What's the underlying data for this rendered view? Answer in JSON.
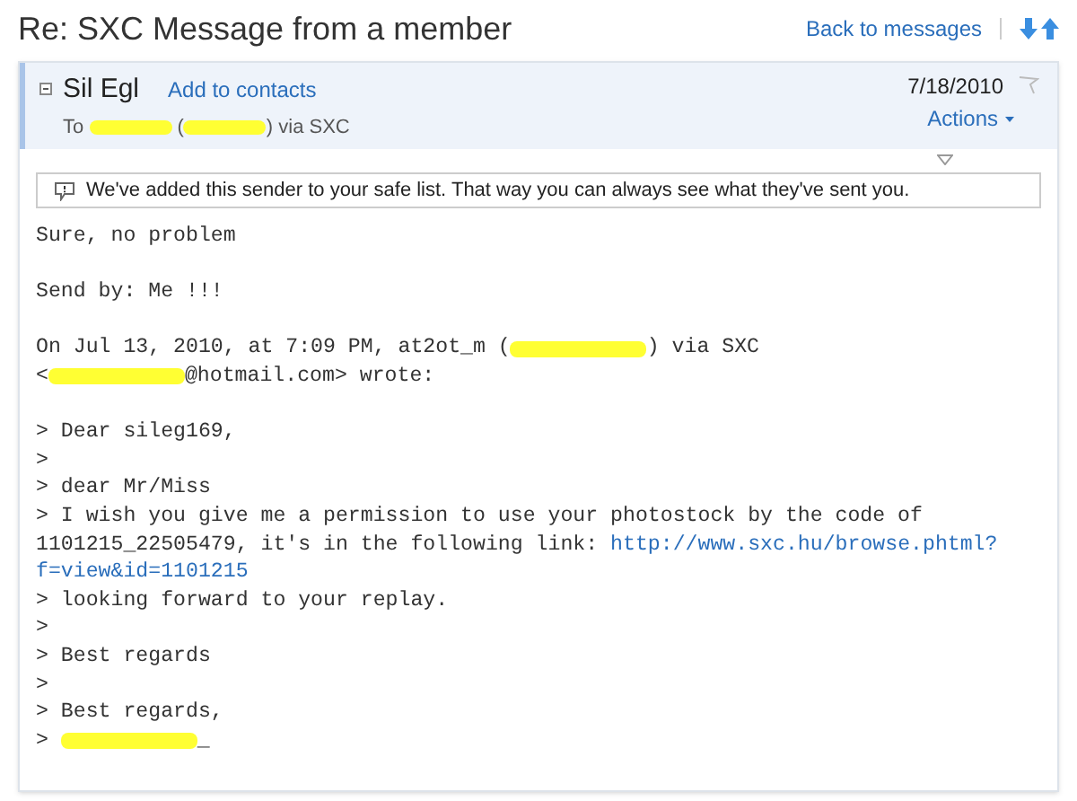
{
  "header": {
    "title": "Re: SXC Message from a member",
    "back_link": "Back to messages"
  },
  "message": {
    "sender": "Sil Egl",
    "add_contact": "Add to contacts",
    "to_line": [
      {
        "kind": "text",
        "text": "To "
      },
      {
        "kind": "redaction"
      },
      {
        "kind": "text",
        "text": " ("
      },
      {
        "kind": "redaction"
      },
      {
        "kind": "text",
        "text": ") via SXC"
      }
    ],
    "date": "7/18/2010",
    "actions": "Actions"
  },
  "notice": {
    "text": "We've added this sender to your safe list. That way you can always see what they've sent you."
  },
  "body": [
    [
      {
        "kind": "text",
        "text": "Sure, no problem"
      }
    ],
    [
      {
        "kind": "blank_line"
      },
      {
        "kind": "text",
        "text": "Send by: Me !!!"
      }
    ],
    [
      {
        "kind": "blank_line"
      },
      {
        "kind": "text",
        "text": "On Jul 13, 2010, at 7:09 PM, at2ot_m ("
      },
      {
        "kind": "redaction"
      },
      {
        "kind": "text",
        "text": ") via SXC"
      }
    ],
    [
      {
        "kind": "text",
        "text": "<"
      },
      {
        "kind": "redaction"
      },
      {
        "kind": "text",
        "text": "@hotmail.com> wrote:"
      }
    ],
    [
      {
        "kind": "blank_line"
      },
      {
        "kind": "text",
        "text": "> Dear sileg169,"
      }
    ],
    [
      {
        "kind": "text",
        "text": ">"
      }
    ],
    [
      {
        "kind": "text",
        "text": "> dear Mr/Miss"
      }
    ],
    [
      {
        "kind": "text",
        "text": "> I wish you give me a permission to use your photostock by the code of"
      }
    ],
    [
      {
        "kind": "text",
        "text": "1101215_22505479, it's in the following link: "
      },
      {
        "kind": "link",
        "text": "http://www.sxc.hu/browse.phtml?"
      }
    ],
    [
      {
        "kind": "link",
        "text": "f=view&id=1101215"
      }
    ],
    [
      {
        "kind": "text",
        "text": "> looking forward to your replay."
      }
    ],
    [
      {
        "kind": "text",
        "text": ">"
      }
    ],
    [
      {
        "kind": "text",
        "text": "> Best regards"
      }
    ],
    [
      {
        "kind": "text",
        "text": ">"
      }
    ],
    [
      {
        "kind": "text",
        "text": "> Best regards,"
      }
    ],
    [
      {
        "kind": "text",
        "text": "> "
      },
      {
        "kind": "redaction"
      },
      {
        "kind": "text",
        "text": "_"
      }
    ]
  ]
}
